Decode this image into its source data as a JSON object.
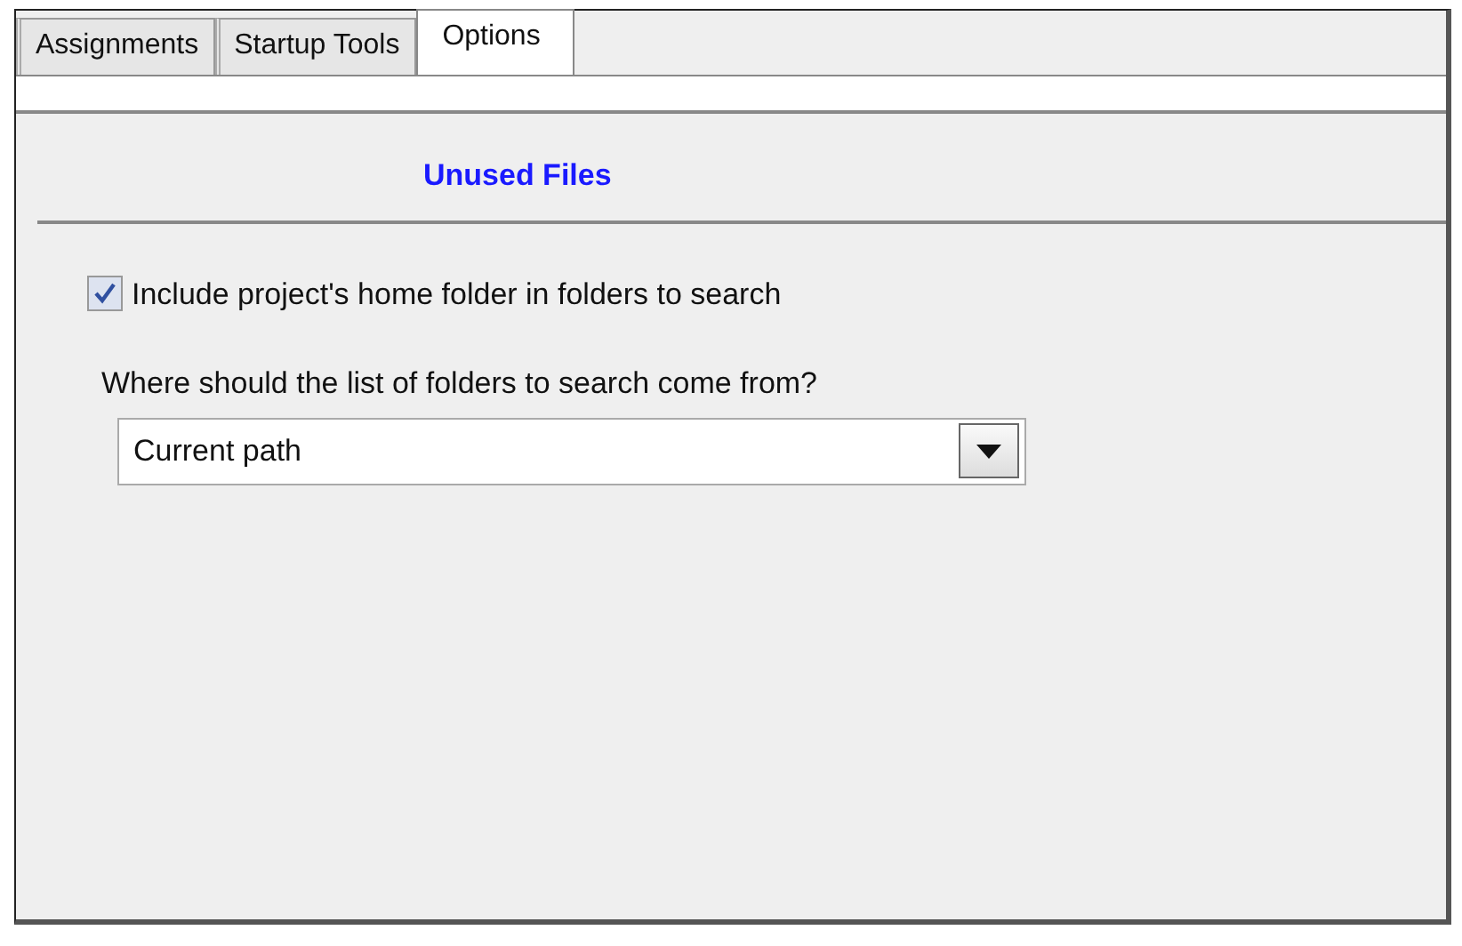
{
  "tabs": [
    {
      "label": "Assignments",
      "selected": false
    },
    {
      "label": "Startup Tools",
      "selected": false
    },
    {
      "label": "Options",
      "selected": true
    }
  ],
  "section_title": "Unused Files",
  "checkbox": {
    "label": "Include project's home folder in folders to search",
    "checked": true
  },
  "folder_source": {
    "label": "Where should the list of folders to search come from?",
    "value": "Current path"
  }
}
